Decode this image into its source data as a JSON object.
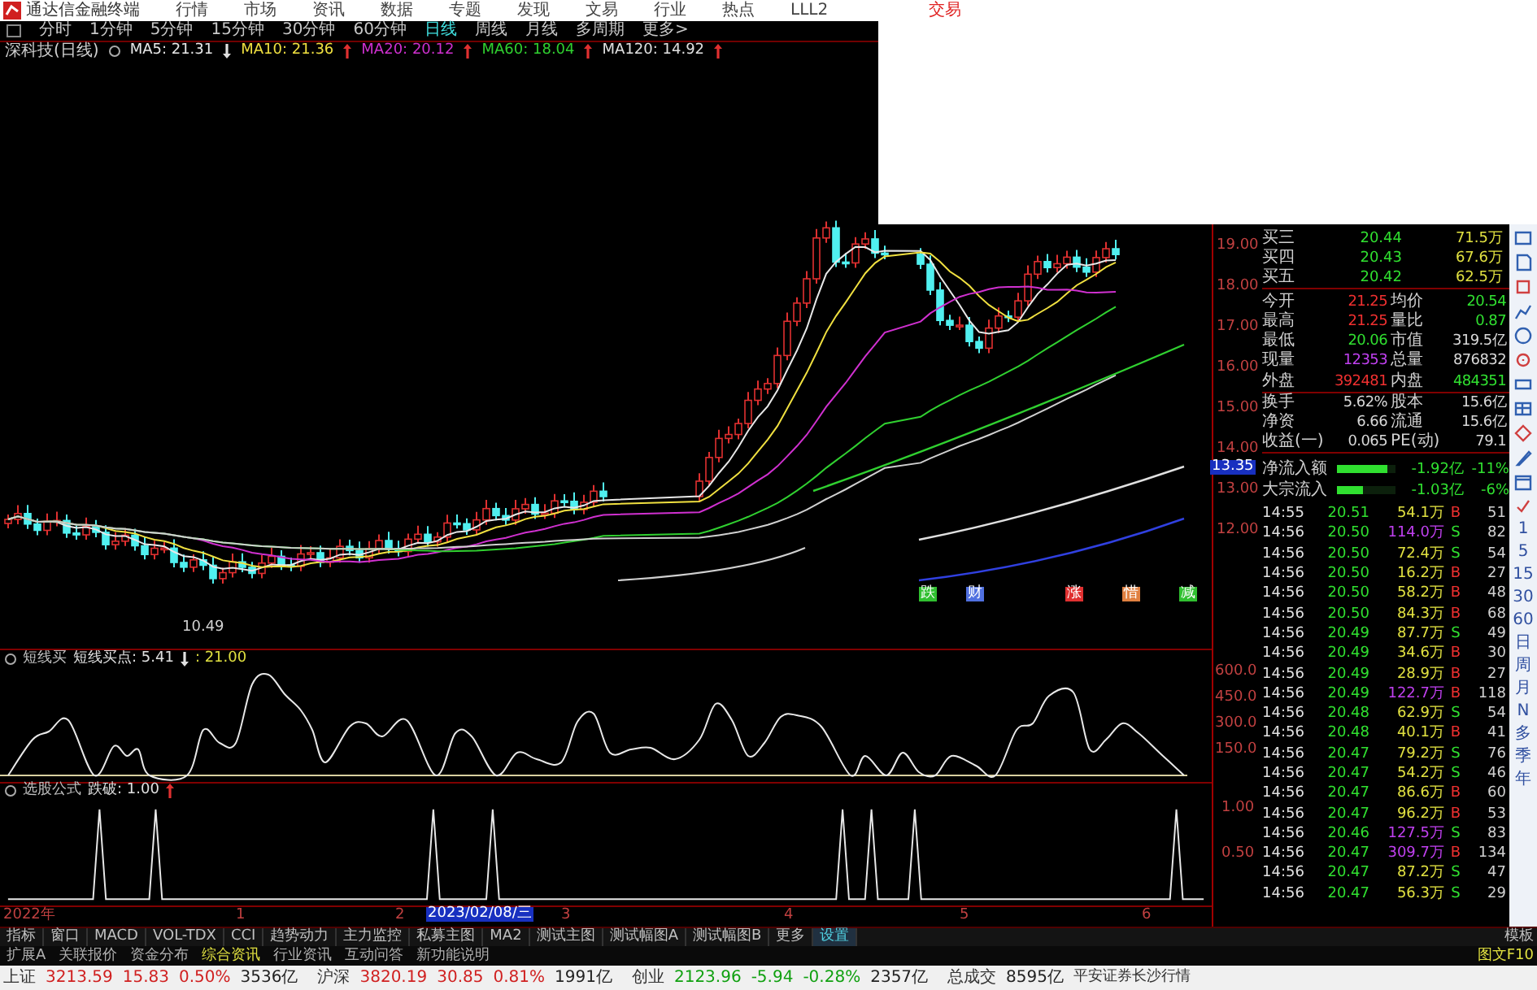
{
  "menu_bar": {
    "app_title": "通达信金融终端",
    "items": [
      "行情",
      "市场",
      "资讯",
      "数据",
      "专题",
      "发现",
      "文易",
      "行业",
      "热点",
      "LLL2"
    ],
    "trade_button": "交易"
  },
  "period_tabs": [
    {
      "label": "分时",
      "selected": false
    },
    {
      "label": "1分钟",
      "selected": false
    },
    {
      "label": "5分钟",
      "selected": false
    },
    {
      "label": "15分钟",
      "selected": false
    },
    {
      "label": "30分钟",
      "selected": false
    },
    {
      "label": "60分钟",
      "selected": false
    },
    {
      "label": "日线",
      "selected": true
    },
    {
      "label": "周线",
      "selected": false
    },
    {
      "label": "月线",
      "selected": false
    },
    {
      "label": "多周期",
      "selected": false
    },
    {
      "label": "更多>",
      "selected": false
    }
  ],
  "chart_title": {
    "security": "深科技(日线)",
    "averages": [
      {
        "label": "MA5: 21.31",
        "rising": false,
        "color": "#e8e8e8"
      },
      {
        "label": "MA10: 21.36",
        "rising": true,
        "color": "#f0e040"
      },
      {
        "label": "MA20: 20.12",
        "rising": true,
        "color": "#d030d0"
      },
      {
        "label": "MA60: 18.04",
        "rising": true,
        "color": "#30d030"
      },
      {
        "label": "MA120: 14.92",
        "rising": true,
        "color": "#e0e0e0"
      }
    ]
  },
  "price_axis": {
    "ticks": [
      "19.00",
      "18.00",
      "17.00",
      "16.00",
      "15.00",
      "14.00",
      "13.00",
      "12.00"
    ],
    "current": "13.35"
  },
  "low_price_label": "10.49",
  "chart_markers": [
    {
      "label": "跌",
      "color": "#30c030"
    },
    {
      "label": "财",
      "color": "#5070e0"
    },
    {
      "label": "涨",
      "color": "#e03030"
    },
    {
      "label": "惜",
      "color": "#e08040"
    },
    {
      "label": "减",
      "color": "#30c030"
    }
  ],
  "indicator_1": {
    "name": "短线买",
    "series_label": "短线买点: 5.41",
    "rising": false,
    "extra": ": 21.00",
    "axis": [
      "600.0",
      "450.0",
      "300.0",
      "150.0"
    ]
  },
  "indicator_2": {
    "name": "选股公式",
    "series_label": "跌破: 1.00",
    "rising": true,
    "axis": [
      "1.00",
      "0.50"
    ]
  },
  "date_axis": {
    "labels": [
      "2022年",
      "1",
      "2",
      "3",
      "4",
      "5",
      "6"
    ],
    "cursor_date": "2023/02/08/三"
  },
  "quote": {
    "order_book": [
      {
        "label": "买三",
        "price": "20.44",
        "volume": "71.5万"
      },
      {
        "label": "买四",
        "price": "20.43",
        "volume": "67.6万"
      },
      {
        "label": "买五",
        "price": "20.42",
        "volume": "62.5万"
      }
    ],
    "stats": [
      {
        "label": "今开",
        "value": {
          "text": "21.25",
          "color": "#f03030"
        },
        "label2": "均价",
        "value2": {
          "text": "20.54",
          "color": "#30e030"
        }
      },
      {
        "label": "最高",
        "value": {
          "text": "21.25",
          "color": "#f03030"
        },
        "label2": "量比",
        "value2": {
          "text": "0.87",
          "color": "#30e030"
        }
      },
      {
        "label": "最低",
        "value": {
          "text": "20.06",
          "color": "#30e030"
        },
        "label2": "市值",
        "value2": {
          "text": "319.5亿",
          "color": "#d8d8d8"
        }
      },
      {
        "label": "现量",
        "value": {
          "text": "12353",
          "color": "#c040f0"
        },
        "label2": "总量",
        "value2": {
          "text": "876832",
          "color": "#d8d8d8"
        }
      },
      {
        "label": "外盘",
        "value": {
          "text": "392481",
          "color": "#f03030"
        },
        "label2": "内盘",
        "value2": {
          "text": "484351",
          "color": "#30e030"
        }
      },
      {
        "label": "换手",
        "value": {
          "text": "5.62%",
          "color": "#d8d8d8"
        },
        "label2": "股本",
        "value2": {
          "text": "15.6亿",
          "color": "#d8d8d8"
        }
      },
      {
        "label": "净资",
        "value": {
          "text": "6.66",
          "color": "#d8d8d8"
        },
        "label2": "流通",
        "value2": {
          "text": "15.6亿",
          "color": "#d8d8d8"
        }
      },
      {
        "label": "收益(一)",
        "value": {
          "text": "0.065",
          "color": "#d8d8d8"
        },
        "label2": "PE(动)",
        "value2": {
          "text": "79.1",
          "color": "#d8d8d8"
        }
      }
    ],
    "flows": [
      {
        "label": "净流入额",
        "level": 0.85,
        "amount": "-1.92亿",
        "pct": "-11%"
      },
      {
        "label": "大宗流入",
        "level": 0.45,
        "amount": "-1.03亿",
        "pct": "-6%"
      }
    ],
    "ticks": [
      {
        "time": "14:55",
        "price": "20.51",
        "volume": "54.1万",
        "large": false,
        "side": "B",
        "buy": true,
        "count": "51"
      },
      {
        "time": "14:56",
        "price": "20.50",
        "volume": "114.0万",
        "large": true,
        "side": "S",
        "buy": false,
        "count": "82"
      },
      {
        "time": "14:56",
        "price": "20.50",
        "volume": "72.4万",
        "large": false,
        "side": "S",
        "buy": false,
        "count": "54"
      },
      {
        "time": "14:56",
        "price": "20.50",
        "volume": "16.2万",
        "large": false,
        "side": "B",
        "buy": true,
        "count": "27"
      },
      {
        "time": "14:56",
        "price": "20.50",
        "volume": "58.2万",
        "large": false,
        "side": "B",
        "buy": true,
        "count": "48"
      },
      {
        "time": "14:56",
        "price": "20.50",
        "volume": "84.3万",
        "large": false,
        "side": "B",
        "buy": true,
        "count": "68"
      },
      {
        "time": "14:56",
        "price": "20.49",
        "volume": "87.7万",
        "large": false,
        "side": "S",
        "buy": false,
        "count": "49"
      },
      {
        "time": "14:56",
        "price": "20.49",
        "volume": "34.6万",
        "large": false,
        "side": "B",
        "buy": true,
        "count": "30"
      },
      {
        "time": "14:56",
        "price": "20.49",
        "volume": "28.9万",
        "large": false,
        "side": "B",
        "buy": true,
        "count": "27"
      },
      {
        "time": "14:56",
        "price": "20.49",
        "volume": "122.7万",
        "large": true,
        "side": "B",
        "buy": true,
        "count": "118"
      },
      {
        "time": "14:56",
        "price": "20.48",
        "volume": "62.9万",
        "large": false,
        "side": "S",
        "buy": false,
        "count": "54"
      },
      {
        "time": "14:56",
        "price": "20.48",
        "volume": "40.1万",
        "large": false,
        "side": "B",
        "buy": true,
        "count": "41"
      },
      {
        "time": "14:56",
        "price": "20.47",
        "volume": "79.2万",
        "large": false,
        "side": "S",
        "buy": false,
        "count": "76"
      },
      {
        "time": "14:56",
        "price": "20.47",
        "volume": "54.2万",
        "large": false,
        "side": "S",
        "buy": false,
        "count": "46"
      },
      {
        "time": "14:56",
        "price": "20.47",
        "volume": "86.6万",
        "large": false,
        "side": "B",
        "buy": true,
        "count": "60"
      },
      {
        "time": "14:56",
        "price": "20.47",
        "volume": "96.2万",
        "large": false,
        "side": "B",
        "buy": true,
        "count": "53"
      },
      {
        "time": "14:56",
        "price": "20.46",
        "volume": "127.5万",
        "large": true,
        "side": "S",
        "buy": false,
        "count": "83"
      },
      {
        "time": "14:56",
        "price": "20.47",
        "volume": "309.7万",
        "large": true,
        "side": "B",
        "buy": true,
        "count": "134"
      },
      {
        "time": "14:56",
        "price": "20.47",
        "volume": "87.2万",
        "large": false,
        "side": "S",
        "buy": false,
        "count": "47"
      },
      {
        "time": "14:56",
        "price": "20.47",
        "volume": "56.3万",
        "large": false,
        "side": "S",
        "buy": false,
        "count": "29"
      }
    ]
  },
  "side_toolbar": {
    "periods": [
      "1",
      "5",
      "15",
      "30",
      "60",
      "日",
      "周",
      "月",
      "N",
      "多",
      "季",
      "年"
    ]
  },
  "bottom_tabs": [
    {
      "label": "指标",
      "selected": false
    },
    {
      "label": "窗口",
      "selected": false
    },
    {
      "label": "MACD",
      "selected": false
    },
    {
      "label": "VOL-TDX",
      "selected": false
    },
    {
      "label": "CCI",
      "selected": false
    },
    {
      "label": "趋势动力",
      "selected": false
    },
    {
      "label": "主力监控",
      "selected": false
    },
    {
      "label": "私募主图",
      "selected": false
    },
    {
      "label": "MA2",
      "selected": false
    },
    {
      "label": "测试主图",
      "selected": false
    },
    {
      "label": "测试幅图A",
      "selected": false
    },
    {
      "label": "测试幅图B",
      "selected": false
    },
    {
      "label": "更多",
      "selected": false
    },
    {
      "label": "设置",
      "selected": true
    }
  ],
  "template_button": "模板",
  "extension_tabs": [
    {
      "label": "扩展A",
      "selected": false
    },
    {
      "label": "关联报价",
      "selected": false
    },
    {
      "label": "资金分布",
      "selected": false
    },
    {
      "label": "综合资讯",
      "selected": true
    },
    {
      "label": "行业资讯",
      "selected": false
    },
    {
      "label": "互动问答",
      "selected": false
    },
    {
      "label": "新功能说明",
      "selected": false
    }
  ],
  "f10_button": "图文F10",
  "status_bar": {
    "indices": [
      {
        "name": "上证",
        "value": "3213.59",
        "change": "15.83",
        "pct": "0.50%",
        "amount": "3536亿",
        "up": true
      },
      {
        "name": "沪深",
        "value": "3820.19",
        "change": "30.85",
        "pct": "0.81%",
        "amount": "1991亿",
        "up": true
      },
      {
        "name": "创业",
        "value": "2123.96",
        "change": "-5.94",
        "pct": "-0.28%",
        "amount": "2357亿",
        "up": false
      }
    ],
    "total_label": "总成交",
    "total": "8595亿",
    "broker": "平安证券长沙行情"
  }
}
